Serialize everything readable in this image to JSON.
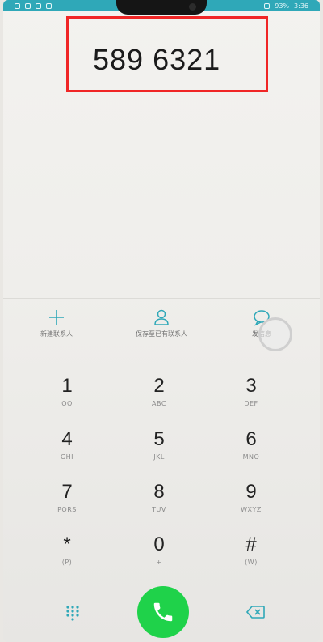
{
  "status_bar": {
    "battery": "93%",
    "time": "3:36"
  },
  "dialer": {
    "number": "589 6321"
  },
  "actions": [
    {
      "label": "新建联系人",
      "icon": "plus-icon"
    },
    {
      "label": "保存至已有联系人",
      "icon": "person-icon"
    },
    {
      "label": "发信息",
      "icon": "message-icon"
    }
  ],
  "keypad": [
    {
      "digit": "1",
      "letters": "QO"
    },
    {
      "digit": "2",
      "letters": "ABC"
    },
    {
      "digit": "3",
      "letters": "DEF"
    },
    {
      "digit": "4",
      "letters": "GHI"
    },
    {
      "digit": "5",
      "letters": "JKL"
    },
    {
      "digit": "6",
      "letters": "MNO"
    },
    {
      "digit": "7",
      "letters": "PQRS"
    },
    {
      "digit": "8",
      "letters": "TUV"
    },
    {
      "digit": "9",
      "letters": "WXYZ"
    },
    {
      "digit": "*",
      "letters": "(P)"
    },
    {
      "digit": "0",
      "letters": "+"
    },
    {
      "digit": "#",
      "letters": "(W)"
    }
  ],
  "colors": {
    "accent": "#2fa8b8",
    "call": "#1fd24a",
    "highlight_box": "#f02626"
  }
}
